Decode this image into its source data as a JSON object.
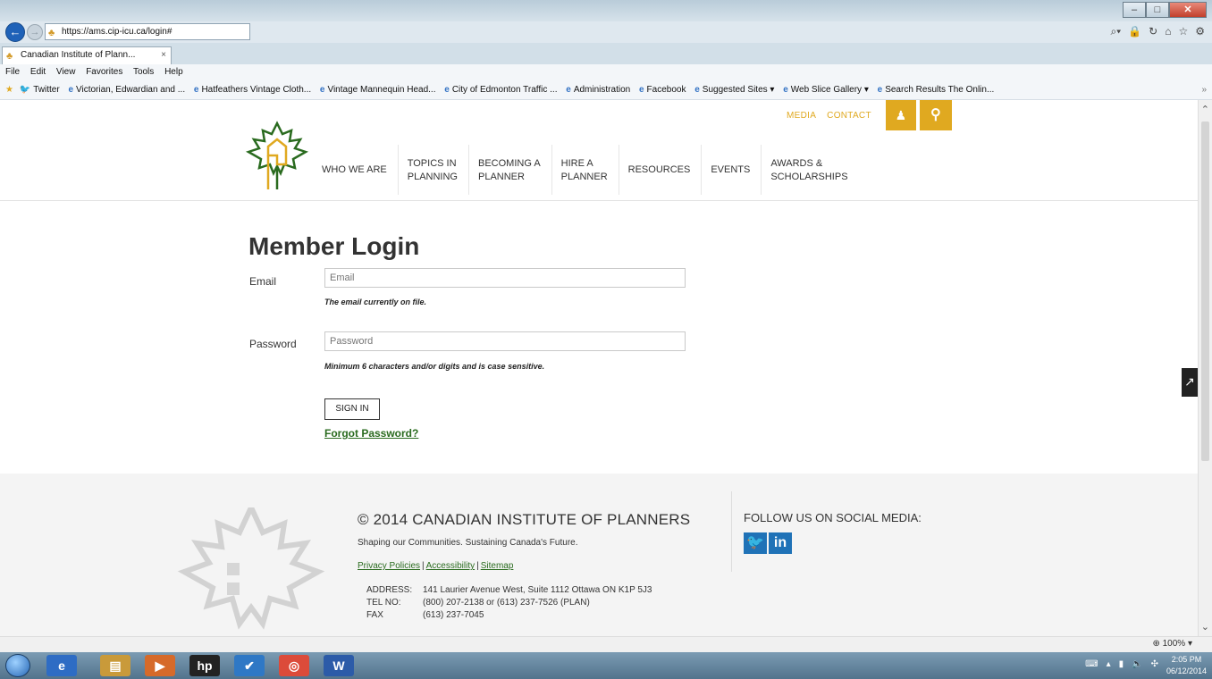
{
  "browser": {
    "url": "https://ams.cip-icu.ca/login#",
    "tab_title": "Canadian Institute of Plann...",
    "tab_close": "×",
    "menu": [
      "File",
      "Edit",
      "View",
      "Favorites",
      "Tools",
      "Help"
    ],
    "favorites": [
      "Twitter",
      "Victorian, Edwardian and ...",
      "Hatfeathers Vintage Cloth...",
      "Vintage Mannequin Head...",
      "City of Edmonton Traffic ...",
      "Administration",
      "Facebook",
      "Suggested Sites ▾",
      "Web Slice Gallery ▾",
      "Search Results  The Onlin..."
    ],
    "zoom": "100%"
  },
  "header": {
    "util_links": [
      "MEDIA",
      "CONTACT"
    ],
    "nav": [
      {
        "line1": "WHO WE ARE",
        "line2": ""
      },
      {
        "line1": "TOPICS IN",
        "line2": "PLANNING"
      },
      {
        "line1": "BECOMING A",
        "line2": "PLANNER"
      },
      {
        "line1": "HIRE A",
        "line2": "PLANNER"
      },
      {
        "line1": "RESOURCES",
        "line2": ""
      },
      {
        "line1": "EVENTS",
        "line2": ""
      },
      {
        "line1": "AWARDS &",
        "line2": "SCHOLARSHIPS"
      }
    ]
  },
  "login": {
    "title": "Member Login",
    "email_label": "Email",
    "email_placeholder": "Email",
    "email_hint": "The email currently on file.",
    "password_label": "Password",
    "password_placeholder": "Password",
    "password_hint": "Minimum 6 characters and/or digits and is case sensitive.",
    "signin_label": "SIGN IN",
    "forgot_label": "Forgot Password?"
  },
  "footer": {
    "copyright": "© 2014 CANADIAN INSTITUTE OF PLANNERS",
    "tagline": "Shaping our Communities. Sustaining Canada's Future.",
    "links": [
      "Privacy Policies",
      "Accessibility",
      "Sitemap"
    ],
    "address_label": "ADDRESS:",
    "address": "141 Laurier Avenue West, Suite 1112 Ottawa ON K1P 5J3",
    "tel_label": "TEL NO:",
    "tel": "(800) 207-2138 or (613) 237-7526 (PLAN)",
    "fax_label": "FAX",
    "fax": "(613) 237-7045",
    "social_title": "FOLLOW US ON SOCIAL MEDIA:"
  },
  "taskbar": {
    "time": "2:05 PM",
    "date": "06/12/2014"
  },
  "colors": {
    "brand_gold": "#e0a920",
    "brand_green": "#2a6b1f",
    "social_blue": "#1f72b7"
  }
}
